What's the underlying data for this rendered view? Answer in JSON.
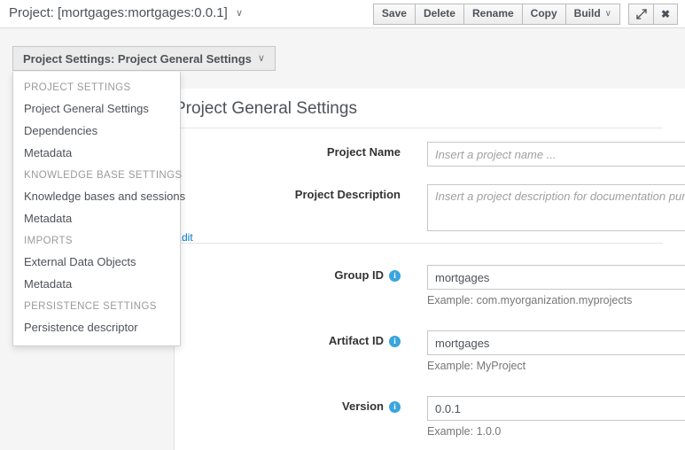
{
  "header": {
    "title": "Project: [mortgages:mortgages:0.0.1]",
    "title_caret": "∨",
    "buttons": [
      {
        "label": "Save",
        "name": "save-button"
      },
      {
        "label": "Delete",
        "name": "delete-button"
      },
      {
        "label": "Rename",
        "name": "rename-button"
      },
      {
        "label": "Copy",
        "name": "copy-button"
      },
      {
        "label": "Build",
        "name": "build-button",
        "caret": "∨"
      }
    ],
    "expand_icon": "expand-arrows-icon",
    "close_icon": "close-icon",
    "close_glyph": "✖"
  },
  "perspective": {
    "label": "Project Settings: Project General Settings",
    "caret": "∨"
  },
  "dropdown": {
    "groups": [
      {
        "header": "PROJECT SETTINGS",
        "items": [
          "Project General Settings",
          "Dependencies",
          "Metadata"
        ]
      },
      {
        "header": "KNOWLEDGE BASE SETTINGS",
        "items": [
          "Knowledge bases and sessions",
          "Metadata"
        ]
      },
      {
        "header": "IMPORTS",
        "items": [
          "External Data Objects",
          "Metadata"
        ]
      },
      {
        "header": "PERSISTENCE SETTINGS",
        "items": [
          "Persistence descriptor"
        ]
      }
    ]
  },
  "panel": {
    "title": "Project General Settings",
    "edit_link": "Edit",
    "fields": [
      {
        "label": "Project Name",
        "name": "project-name",
        "value": "",
        "placeholder": "Insert a project name ...",
        "info": true,
        "has_info_icon": false,
        "type": "input",
        "hint": ""
      },
      {
        "label": "Project Description",
        "name": "project-description",
        "value": "",
        "placeholder": "Insert a project description for documentation purposes ...",
        "has_info_icon": false,
        "type": "textarea",
        "hint": ""
      },
      {
        "label": "Group ID",
        "name": "group-id",
        "value": "mortgages",
        "placeholder": "",
        "has_info_icon": true,
        "type": "input",
        "hint": "Example: com.myorganization.myprojects"
      },
      {
        "label": "Artifact ID",
        "name": "artifact-id",
        "value": "mortgages",
        "placeholder": "",
        "has_info_icon": true,
        "type": "input",
        "hint": "Example: MyProject"
      },
      {
        "label": "Version",
        "name": "version",
        "value": "0.0.1",
        "placeholder": "",
        "has_info_icon": true,
        "type": "input",
        "hint": "Example: 1.0.0"
      }
    ],
    "info_glyph": "i"
  },
  "colors": {
    "accent_link": "#0077cc",
    "info_icon": "#39a5dc",
    "body_bg": "#f5f5f5",
    "text": "#4d5258"
  }
}
